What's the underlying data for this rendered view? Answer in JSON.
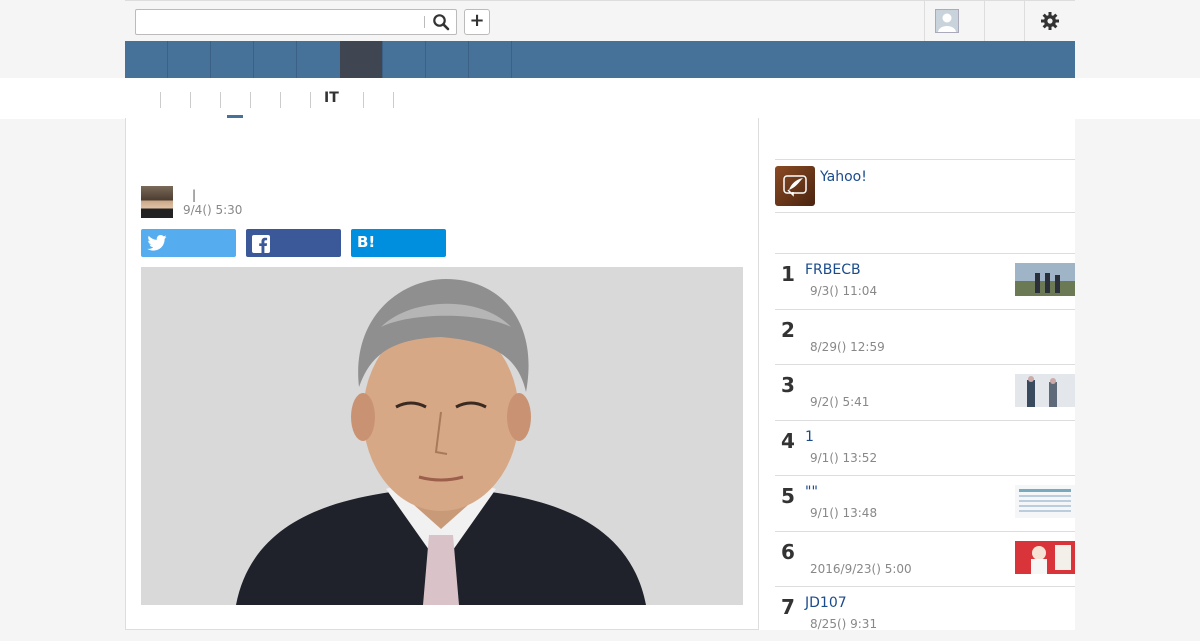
{
  "header": {
    "search_placeholder": "",
    "plus_label": "+",
    "icons": [
      "search-icon",
      "avatar",
      "gear-icon"
    ]
  },
  "subnav": {
    "active_label": "IT"
  },
  "article": {
    "title": "",
    "author_separator": "|",
    "date": "9/4() 5:30",
    "share": {
      "hatena_label": "B!"
    }
  },
  "sidebar": {
    "yahoo_label": "Yahoo!",
    "ranking": [
      {
        "rank": "1",
        "title": "FRBECB",
        "date": "9/3() 11:04",
        "thumb": true
      },
      {
        "rank": "2",
        "title": "",
        "date": "8/29() 12:59",
        "thumb": false
      },
      {
        "rank": "3",
        "title": "",
        "date": "9/2() 5:41",
        "thumb": true
      },
      {
        "rank": "4",
        "title": "1",
        "date": "9/1() 13:52",
        "thumb": false
      },
      {
        "rank": "5",
        "title": "\"\"",
        "date": "9/1() 13:48",
        "thumb": true
      },
      {
        "rank": "6",
        "title": "",
        "date": "2016/9/23() 5:00",
        "thumb": true
      },
      {
        "rank": "7",
        "title": "JD107",
        "date": "8/25() 9:31",
        "thumb": false
      }
    ]
  },
  "colors": {
    "nav": "#467199",
    "nav_active": "#3f4652",
    "twitter": "#55acee",
    "facebook": "#3b5998",
    "hatena": "#008fde",
    "link": "#1a4b8c"
  }
}
